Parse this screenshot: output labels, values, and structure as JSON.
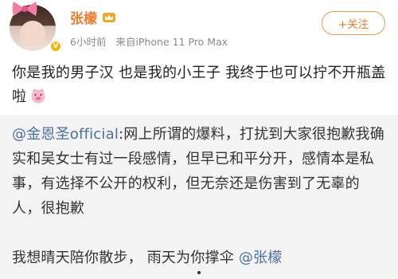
{
  "post": {
    "username": "张檬",
    "time": "6小时前",
    "source": "来自iPhone 11 Pro Max",
    "follow_label": "+关注",
    "text": "你是我的男子汉  也是我的小王子  我终于也可以拧不开瓶盖啦"
  },
  "repost": {
    "mention_author": "@金恩圣official",
    "body": ":网上所谓的爆料，打扰到大家很抱歉我确实和吴女士有过一段感情，但早已和平分开，感情本是私事，有选择不公开的权利，但无奈还是伤害到了无辜的人，很抱歉",
    "line2_text": "我想晴天陪你散步，  雨天为你撑伞 ",
    "line2_mention": "@张檬"
  },
  "icons": {
    "avatar_badge": "verified-icon",
    "name_badge": "crown-icon",
    "emoji": "pig-icon"
  },
  "colors": {
    "username": "#f07b2d",
    "mention": "#4a6fa5",
    "repost_bg": "#f4f4f4"
  }
}
